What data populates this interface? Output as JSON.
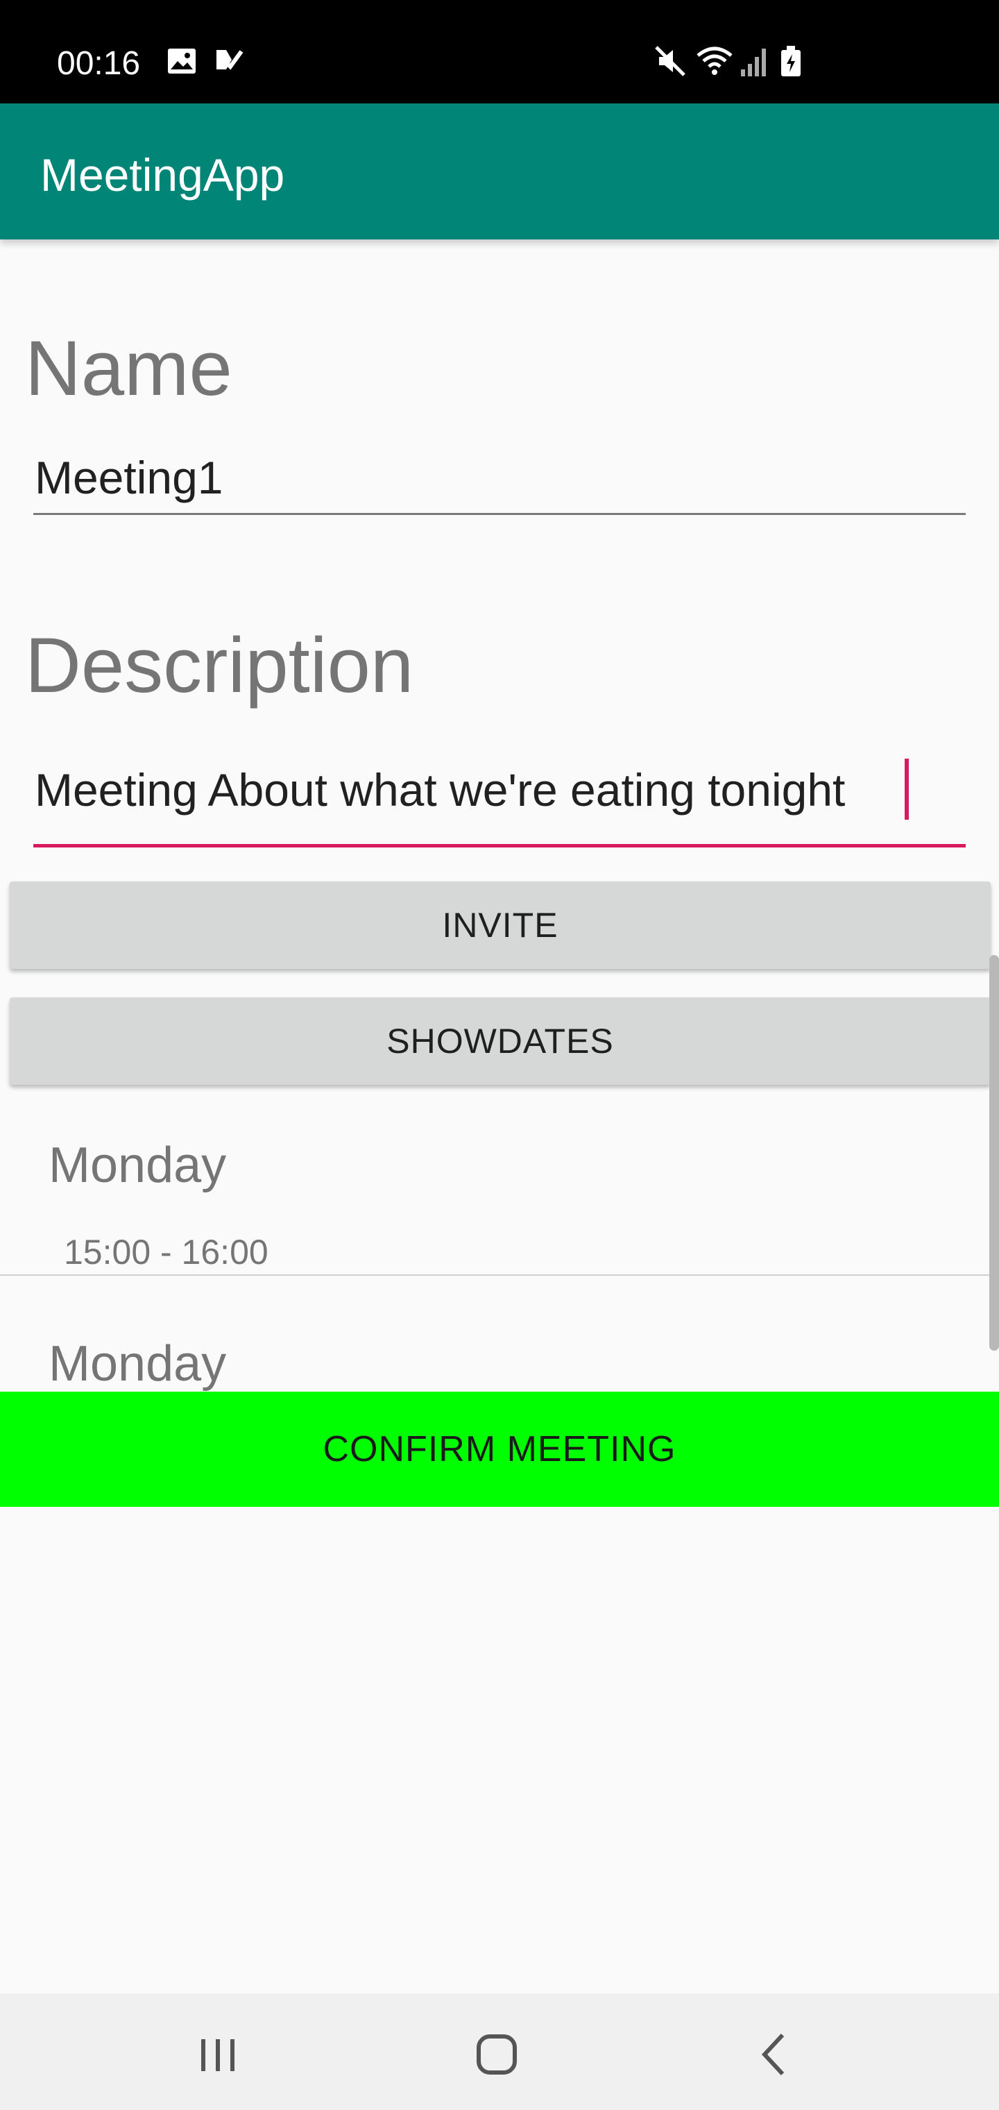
{
  "status_bar": {
    "time": "00:16",
    "left_icons": [
      "image-icon",
      "check-icon"
    ],
    "right_icons": [
      "mute-icon",
      "wifi-icon",
      "signal-icon",
      "battery-icon"
    ]
  },
  "app_bar": {
    "title": "MeetingApp",
    "color": "#008577"
  },
  "form": {
    "name_label": "Name",
    "name_value": "Meeting1",
    "description_label": "Description",
    "description_value": "Meeting About what we're eating tonight",
    "accent_color": "#d81b60"
  },
  "buttons": {
    "invite": "INVITE",
    "showdates": "SHOWDATES",
    "confirm": "CONFIRM MEETING",
    "confirm_color": "#00ff00"
  },
  "dates": [
    {
      "day": "Monday",
      "time": "15:00 - 16:00"
    },
    {
      "day": "Monday",
      "time": ""
    }
  ],
  "nav_bar": {
    "icons": [
      "recent-apps-icon",
      "home-icon",
      "back-icon"
    ]
  }
}
